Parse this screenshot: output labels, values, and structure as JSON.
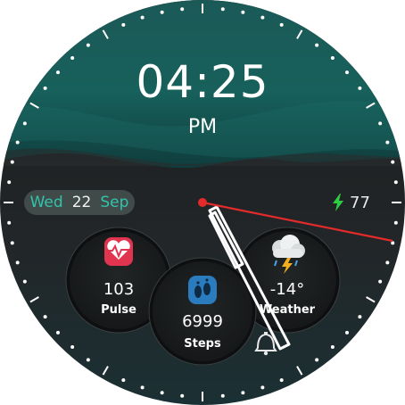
{
  "clock": {
    "time": "04:25",
    "ampm": "PM"
  },
  "date": {
    "weekday": "Wed",
    "day": "22",
    "month": "Sep"
  },
  "battery": {
    "level": "77"
  },
  "complications": {
    "pulse": {
      "value": "103",
      "label": "Pulse",
      "icon": "heart-rate-icon"
    },
    "steps": {
      "value": "6999",
      "label": "Steps",
      "icon": "footsteps-icon"
    },
    "weather": {
      "value": "-14°",
      "label": "Weather",
      "icon": "thunderstorm-icon"
    }
  },
  "icons": {
    "notification": "bell-icon",
    "battery": "lightning-icon"
  },
  "colors": {
    "accent_teal": "#33c3ad",
    "heart_red": "#e0344f",
    "second_hand": "#e32b2b",
    "battery_green": "#2ecc40",
    "steps_blue": "#2b7bbf"
  }
}
